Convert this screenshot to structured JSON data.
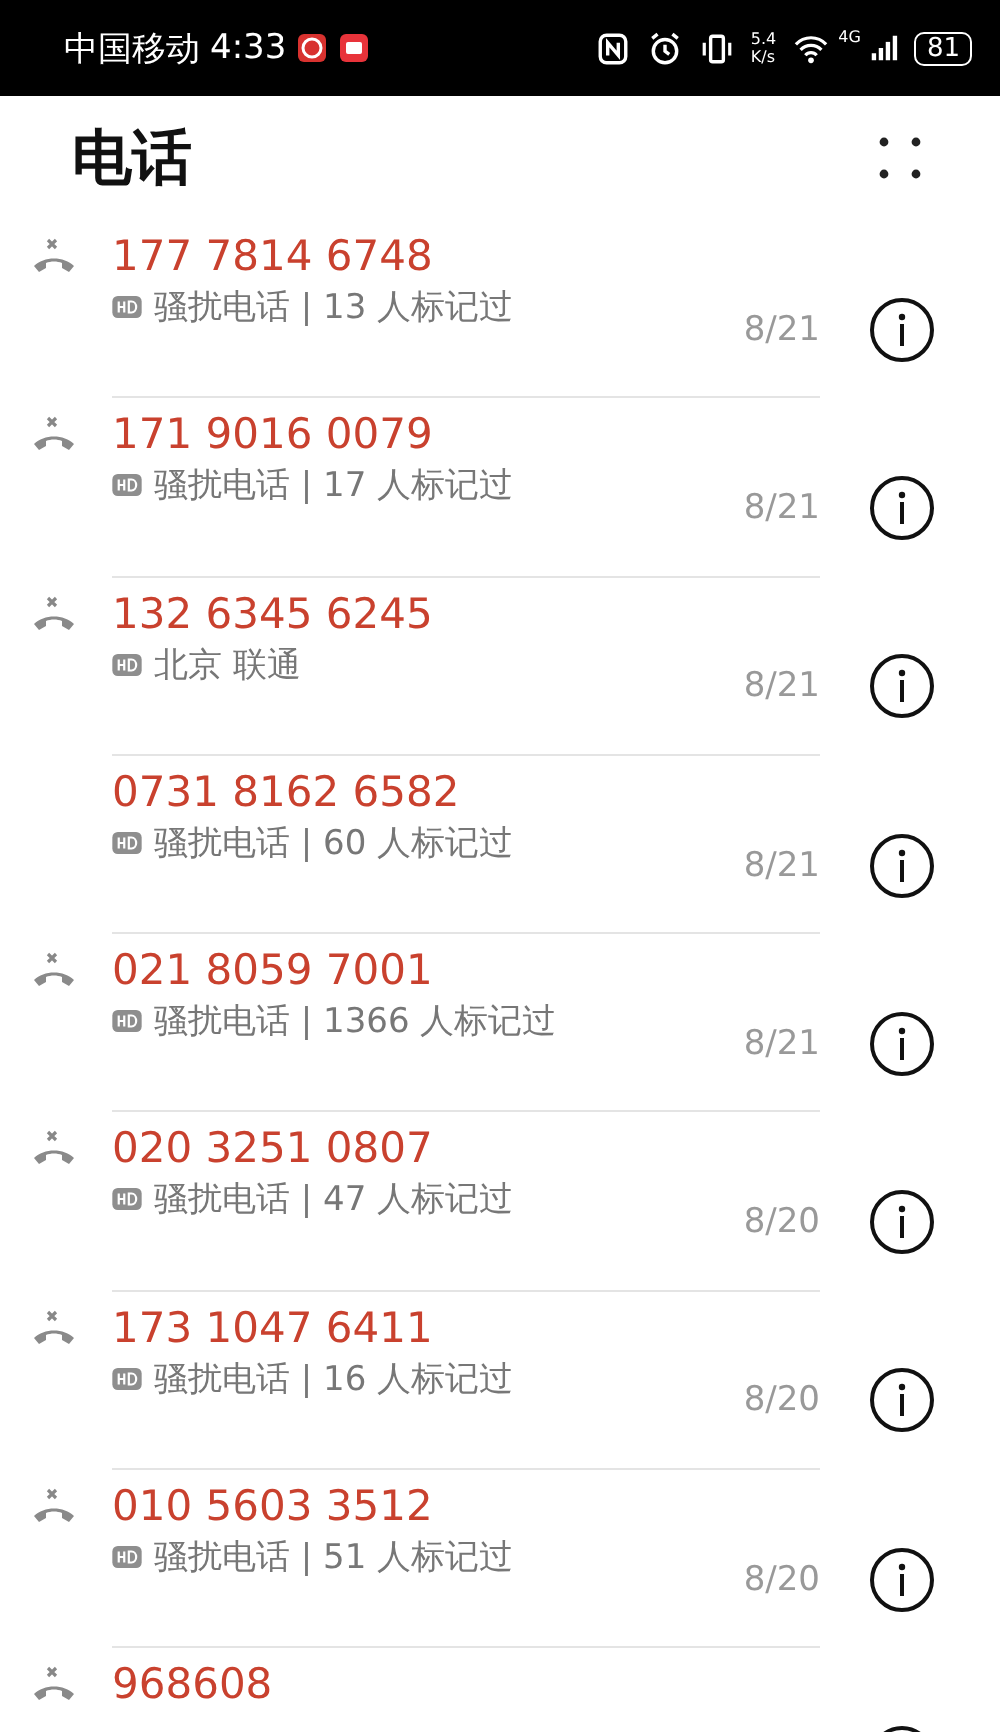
{
  "status_bar": {
    "carrier": "中国移动",
    "time": "4:33",
    "network_speed_value": "5.4",
    "network_speed_unit": "K/s",
    "network_type": "4G",
    "battery": "81"
  },
  "header": {
    "title": "电话"
  },
  "calls": [
    {
      "number": "177 7814 6748",
      "missed": true,
      "detail": "骚扰电话 | 13 人标记过",
      "date": "8/21"
    },
    {
      "number": "171 9016 0079",
      "missed": true,
      "detail": "骚扰电话 | 17 人标记过",
      "date": "8/21"
    },
    {
      "number": "132 6345 6245",
      "missed": true,
      "detail": "北京 联通",
      "date": "8/21"
    },
    {
      "number": "0731 8162 6582",
      "missed": false,
      "detail": "骚扰电话 | 60 人标记过",
      "date": "8/21"
    },
    {
      "number": "021 8059 7001",
      "missed": true,
      "detail": "骚扰电话 | 1366 人标记过",
      "date": "8/21"
    },
    {
      "number": "020 3251 0807",
      "missed": true,
      "detail": "骚扰电话 | 47 人标记过",
      "date": "8/20"
    },
    {
      "number": "173 1047 6411",
      "missed": true,
      "detail": "骚扰电话 | 16 人标记过",
      "date": "8/20"
    },
    {
      "number": "010 5603 3512",
      "missed": true,
      "detail": "骚扰电话 | 51 人标记过",
      "date": "8/20"
    },
    {
      "number": "968608",
      "missed": true
    }
  ]
}
